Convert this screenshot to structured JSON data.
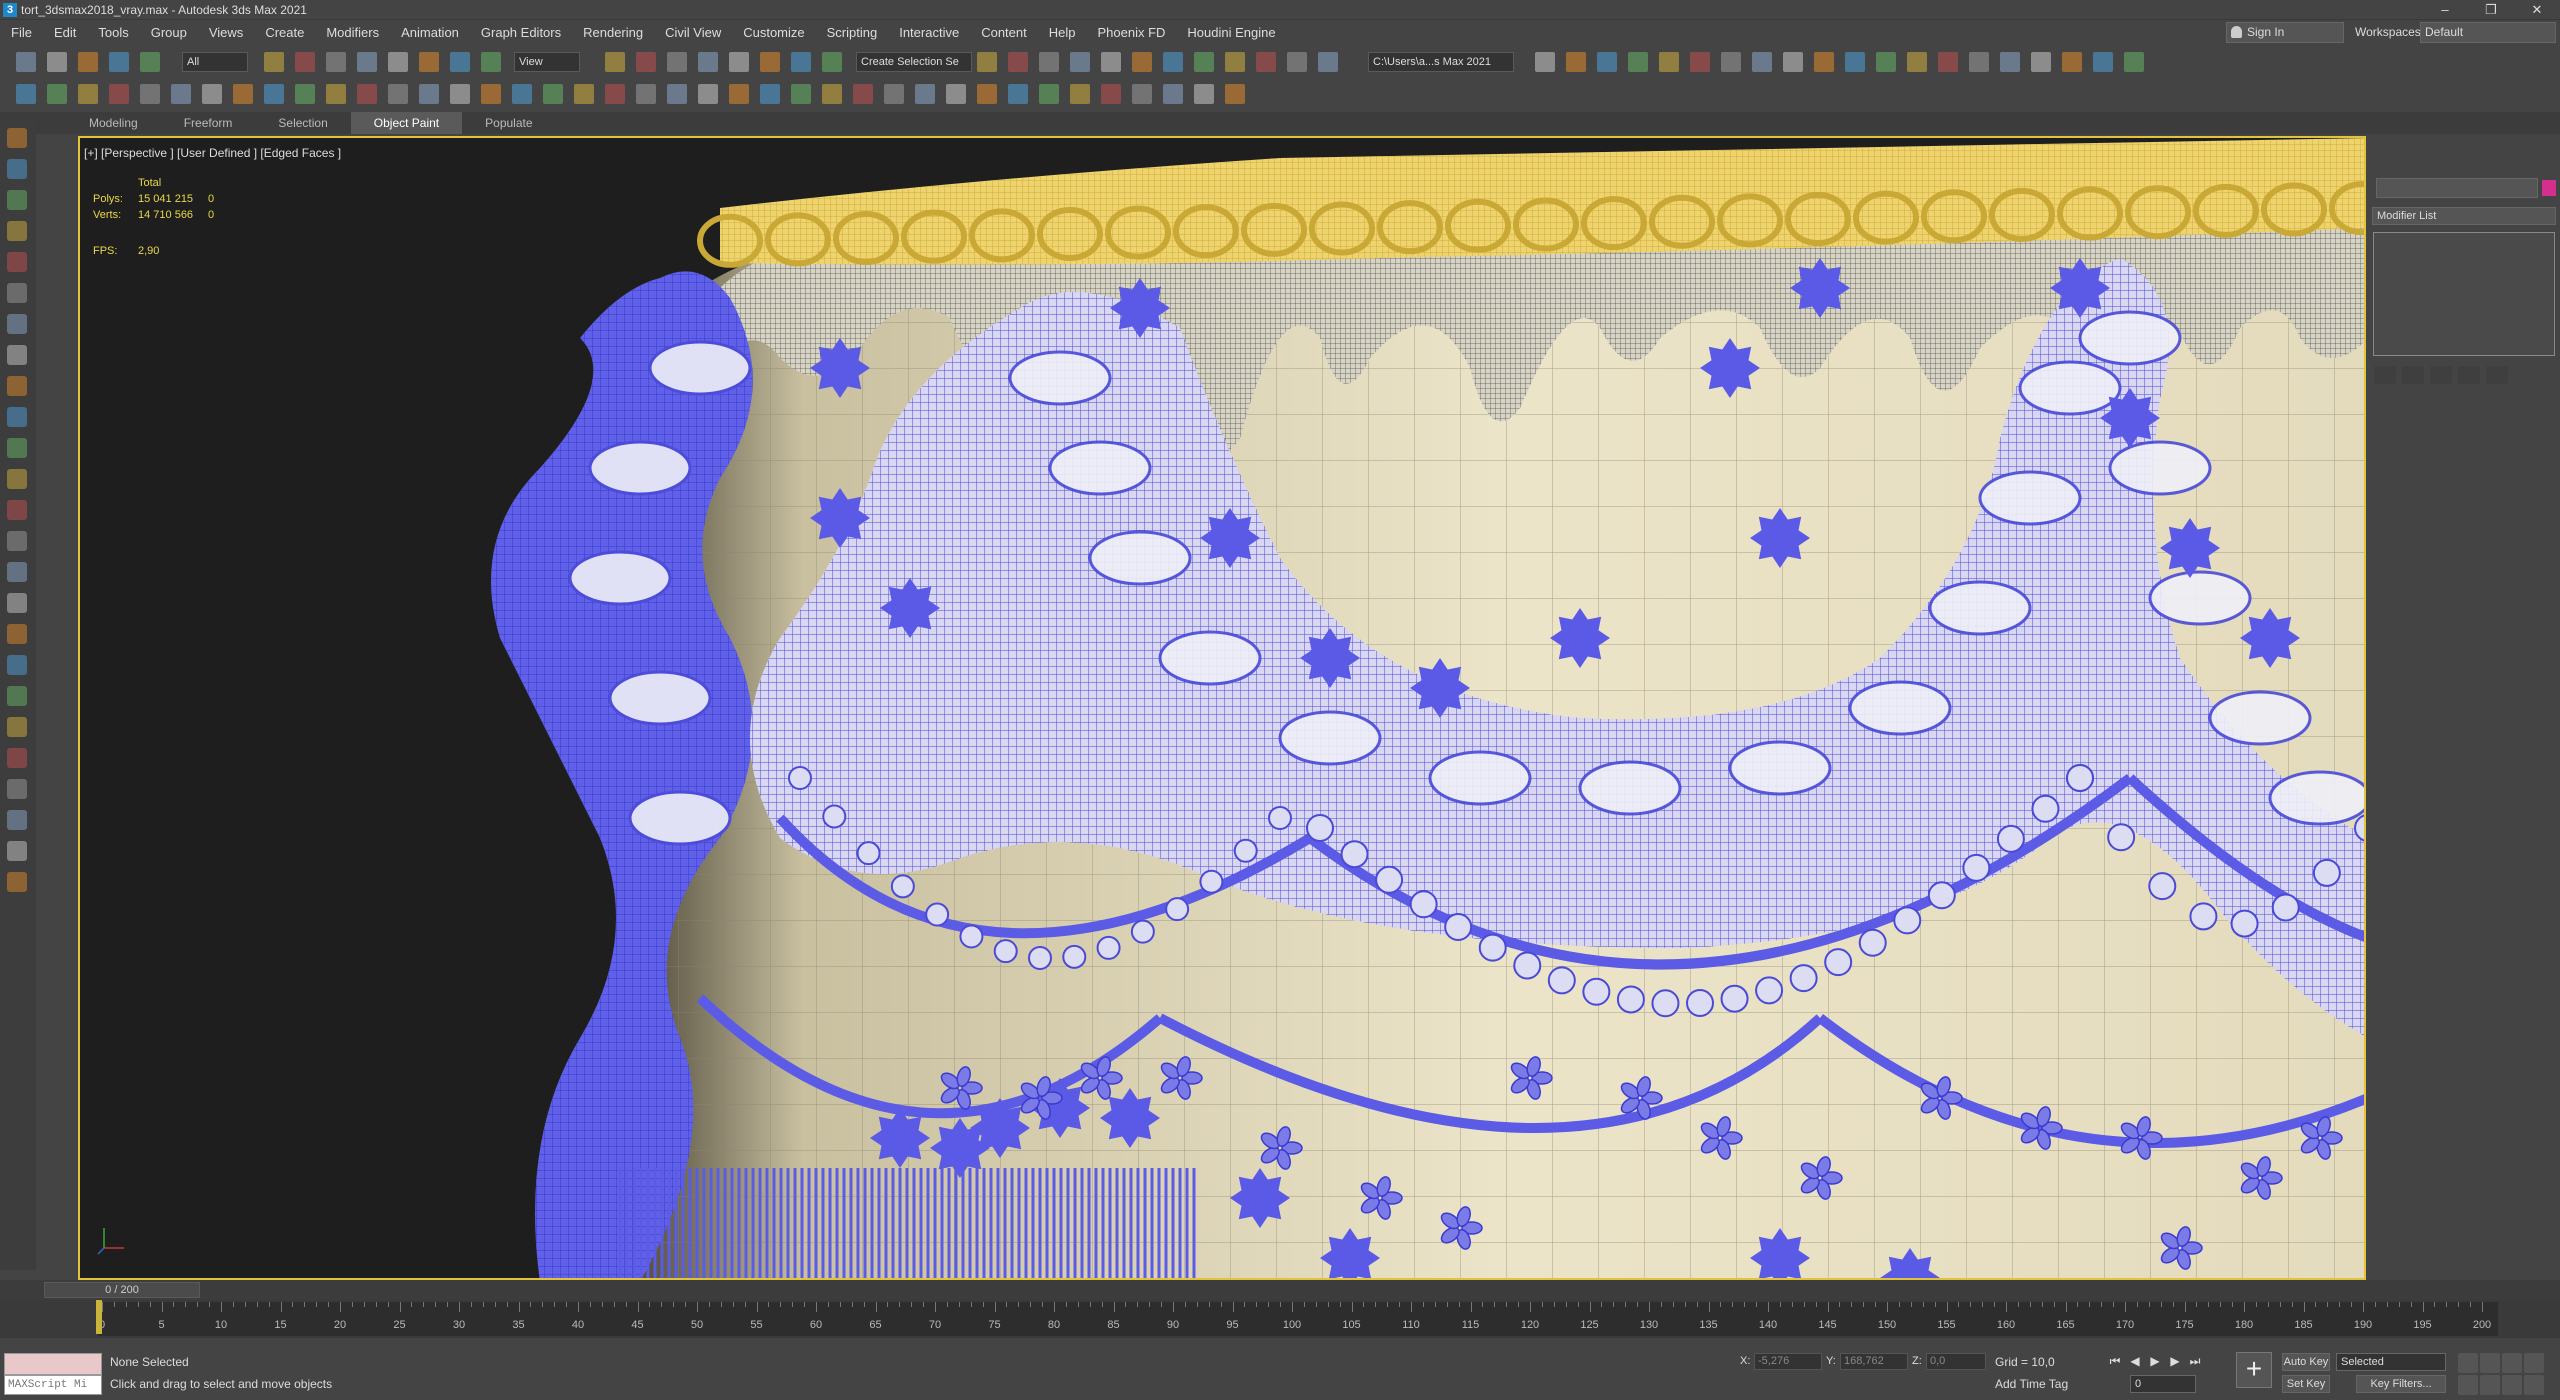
{
  "title_bar": {
    "title": "tort_3dsmax2018_vray.max - Autodesk 3ds Max 2021",
    "app_icon": "3",
    "minimize": "–",
    "maximize": "❐",
    "close": "✕"
  },
  "menu": {
    "items": [
      "File",
      "Edit",
      "Tools",
      "Group",
      "Views",
      "Create",
      "Modifiers",
      "Animation",
      "Graph Editors",
      "Rendering",
      "Civil View",
      "Customize",
      "Scripting",
      "Interactive",
      "Content",
      "Help",
      "Phoenix FD",
      "Houdini Engine"
    ],
    "sign_in": "Sign In",
    "workspaces_label": "Workspaces:",
    "workspace": "Default"
  },
  "toolbar": {
    "selection_filter": "All",
    "ref_coord": "View",
    "selection_set": "Create Selection Se",
    "project_path": "C:\\Users\\a...s Max 2021"
  },
  "ribbon": {
    "tabs": [
      "Modeling",
      "Freeform",
      "Selection",
      "Object Paint",
      "Populate"
    ],
    "active_tab": "Object Paint"
  },
  "viewport": {
    "label": "[+] [Perspective ] [User Defined ] [Edged Faces ]",
    "stats": {
      "total_label": "Total",
      "polys_label": "Polys:",
      "polys_total": "15 041 215",
      "polys_sel": "0",
      "verts_label": "Verts:",
      "verts_total": "14 710 566",
      "verts_sel": "0",
      "fps_label": "FPS:",
      "fps_value": "2,90"
    }
  },
  "command_panel": {
    "modifier_list": "Modifier List",
    "object_color": "#d42f8f"
  },
  "timeline": {
    "slider": "0 / 200",
    "ticks": [
      0,
      5,
      10,
      15,
      20,
      25,
      30,
      35,
      40,
      45,
      50,
      55,
      60,
      65,
      70,
      75,
      80,
      85,
      90,
      95,
      100,
      105,
      110,
      115,
      120,
      125,
      130,
      135,
      140,
      145,
      150,
      155,
      160,
      165,
      170,
      175,
      180,
      185,
      190,
      195,
      200
    ],
    "start": 0,
    "end": 200
  },
  "status": {
    "maxscript": "MAXScript Mi",
    "selection": "None Selected",
    "prompt": "Click and drag to select and move objects",
    "x_label": "X:",
    "x_value": "-5,276",
    "y_label": "Y:",
    "y_value": "168,762",
    "z_label": "Z:",
    "z_value": "0,0",
    "grid": "Grid = 10,0",
    "add_time_tag": "Add Time Tag",
    "auto_key": "Auto Key",
    "set_key": "Set Key",
    "key_mode": "Selected",
    "key_filters": "Key Filters...",
    "current_frame": "0"
  },
  "colors": {
    "viewport_border": "#e0c43c",
    "wire_blue": "#5b5be6",
    "cake_cream": "#e9e1c6",
    "gold_trim": "#f0d36a"
  }
}
